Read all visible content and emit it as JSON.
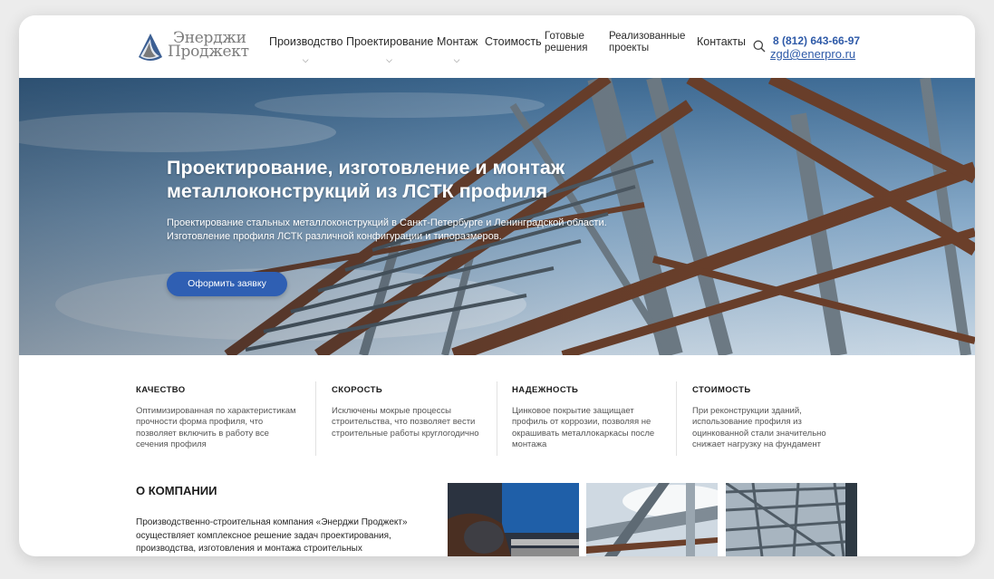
{
  "brand": {
    "line1": "Энерджи",
    "line2": "Проджект",
    "color_accent": "#2e5aa8",
    "logo_mark_color": "#3c5f93"
  },
  "nav": {
    "items": [
      {
        "label": "Производство",
        "has_dropdown": true
      },
      {
        "label": "Проектирование",
        "has_dropdown": true
      },
      {
        "label": "Монтаж",
        "has_dropdown": true
      },
      {
        "label": "Стоимость",
        "has_dropdown": false
      },
      {
        "label_line1": "Готовые",
        "label_line2": "решения"
      },
      {
        "label_line1": "Реализованные",
        "label_line2": "проекты"
      },
      {
        "label": "Контакты",
        "has_dropdown": false
      }
    ],
    "chevron": "⌵"
  },
  "contacts": {
    "phone": "8 (812) 643-66-97",
    "email": "zgd@enerpro.ru"
  },
  "hero": {
    "title": "Проектирование, изготовление и монтаж металлоконструкций из ЛСТК профиля",
    "subtitle_line1": "Проектирование стальных металлоконструкций в Санкт-Петербурге и Ленинградской области.",
    "subtitle_line2": "Изготовление профиля ЛСТК различной конфигурации и типоразмеров.",
    "button": "Оформить заявку"
  },
  "features": [
    {
      "title": "КАЧЕСТВО",
      "text": "Оптимизированная по характеристикам прочности форма профиля, что позволяет включить в работу все сечения профиля"
    },
    {
      "title": "СКОРОСТЬ",
      "text": "Исключены мокрые процессы строительства, что позволяет вести строительные работы круглогодично"
    },
    {
      "title": "НАДЕЖНОСТЬ",
      "text": "Цинковое покрытие защищает профиль от коррозии, позволяя не окрашивать металлокаркасы после монтажа"
    },
    {
      "title": "СТОИМОСТЬ",
      "text": "При реконструкции зданий, использование профиля из оцинкованной стали значительно снижает нагрузку на фундамент"
    }
  ],
  "about": {
    "title": "О КОМПАНИИ",
    "text": "Производственно-строительная компания «Энерджи Проджект» осуществляет комплексное решение задач проектирования, производства, изготовления и монтажа строительных"
  }
}
